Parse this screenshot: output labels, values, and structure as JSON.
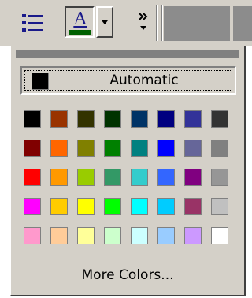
{
  "toolbar": {
    "font_color_letter": "A",
    "font_color_bar": "#006000"
  },
  "panel": {
    "automatic_label": "Automatic",
    "automatic_color": "#000000",
    "more_colors_label": "More Colors...",
    "palette": [
      [
        "#000000",
        "#993300",
        "#333300",
        "#003300",
        "#003366",
        "#000080",
        "#333399",
        "#333333"
      ],
      [
        "#800000",
        "#FF6600",
        "#808000",
        "#008000",
        "#008080",
        "#0000FF",
        "#666699",
        "#808080"
      ],
      [
        "#FF0000",
        "#FF9900",
        "#99CC00",
        "#339966",
        "#33CCCC",
        "#3366FF",
        "#800080",
        "#969696"
      ],
      [
        "#FF00FF",
        "#FFCC00",
        "#FFFF00",
        "#00FF00",
        "#00FFFF",
        "#00CCFF",
        "#993366",
        "#C0C0C0"
      ],
      [
        "#FF99CC",
        "#FFCC99",
        "#FFFF99",
        "#CCFFCC",
        "#CCFFFF",
        "#99CCFF",
        "#CC99FF",
        "#FFFFFF"
      ]
    ]
  }
}
